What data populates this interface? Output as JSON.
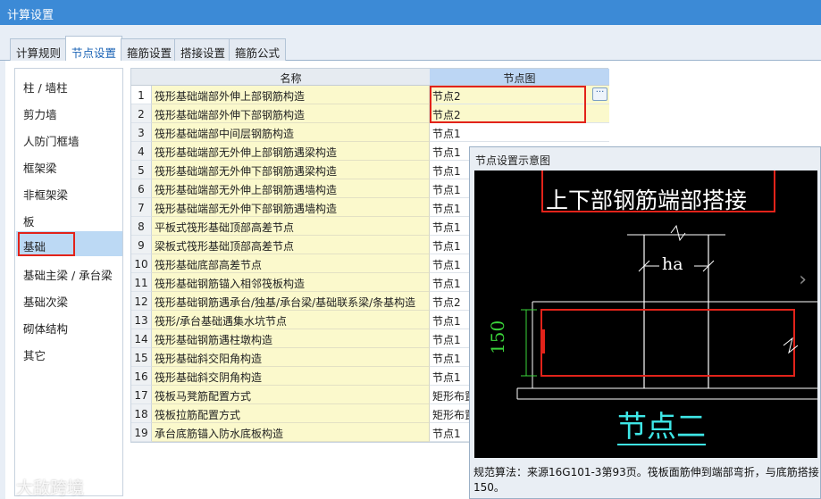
{
  "window": {
    "title": "计算设置"
  },
  "tabs": [
    {
      "label": "计算规则"
    },
    {
      "label": "节点设置"
    },
    {
      "label": "箍筋设置"
    },
    {
      "label": "搭接设置"
    },
    {
      "label": "箍筋公式"
    }
  ],
  "sidebar": {
    "items": [
      {
        "label": "柱 / 墙柱"
      },
      {
        "label": "剪力墙"
      },
      {
        "label": "人防门框墙"
      },
      {
        "label": "框架梁"
      },
      {
        "label": "非框架梁"
      },
      {
        "label": "板"
      },
      {
        "label": "基础"
      },
      {
        "label": "基础主梁 / 承台梁"
      },
      {
        "label": "基础次梁"
      },
      {
        "label": "砌体结构"
      },
      {
        "label": "其它"
      }
    ]
  },
  "grid": {
    "headers": {
      "name": "名称",
      "node": "节点图"
    },
    "rows": [
      {
        "num": "1",
        "name": "筏形基础端部外伸上部钢筋构造",
        "node": "节点2"
      },
      {
        "num": "2",
        "name": "筏形基础端部外伸下部钢筋构造",
        "node": "节点2"
      },
      {
        "num": "3",
        "name": "筏形基础端部中间层钢筋构造",
        "node": "节点1"
      },
      {
        "num": "4",
        "name": "筏形基础端部无外伸上部钢筋遇梁构造",
        "node": "节点1"
      },
      {
        "num": "5",
        "name": "筏形基础端部无外伸下部钢筋遇梁构造",
        "node": "节点1"
      },
      {
        "num": "6",
        "name": "筏形基础端部无外伸上部钢筋遇墙构造",
        "node": "节点1"
      },
      {
        "num": "7",
        "name": "筏形基础端部无外伸下部钢筋遇墙构造",
        "node": "节点1"
      },
      {
        "num": "8",
        "name": "平板式筏形基础顶部高差节点",
        "node": "节点1"
      },
      {
        "num": "9",
        "name": "梁板式筏形基础顶部高差节点",
        "node": "节点1"
      },
      {
        "num": "10",
        "name": "筏形基础底部高差节点",
        "node": "节点1"
      },
      {
        "num": "11",
        "name": "筏形基础钢筋锚入相邻筏板构造",
        "node": "节点1"
      },
      {
        "num": "12",
        "name": "筏形基础钢筋遇承台/独基/承台梁/基础联系梁/条基构造",
        "node": "节点2"
      },
      {
        "num": "13",
        "name": "筏形/承台基础遇集水坑节点",
        "node": "节点1"
      },
      {
        "num": "14",
        "name": "筏形基础钢筋遇柱墩构造",
        "node": "节点1"
      },
      {
        "num": "15",
        "name": "筏形基础斜交阳角构造",
        "node": "节点1"
      },
      {
        "num": "16",
        "name": "筏形基础斜交阴角构造",
        "node": "节点1"
      },
      {
        "num": "17",
        "name": "筏板马凳筋配置方式",
        "node": "矩形布置"
      },
      {
        "num": "18",
        "name": "筏板拉筋配置方式",
        "node": "矩形布置"
      },
      {
        "num": "19",
        "name": "承台底筋锚入防水底板构造",
        "node": "节点1"
      }
    ],
    "ellipsis_label": "···"
  },
  "preview": {
    "title": "节点设置示意图",
    "heading": "上下部钢筋端部搭接",
    "dim_ha": "ha",
    "dim_150": "150",
    "caption": "节点二",
    "note": "规范算法：来源16G101-3第93页。筏板面筋伸到端部弯折，与底筋搭接150。",
    "chevron": "›"
  },
  "watermark": "大敌跨境",
  "colors": {
    "titlebar": "#3c8ad6",
    "highlight": "#e2231a",
    "yellow_cell": "#fbf9cc",
    "selected_side": "#bcd9f4"
  }
}
